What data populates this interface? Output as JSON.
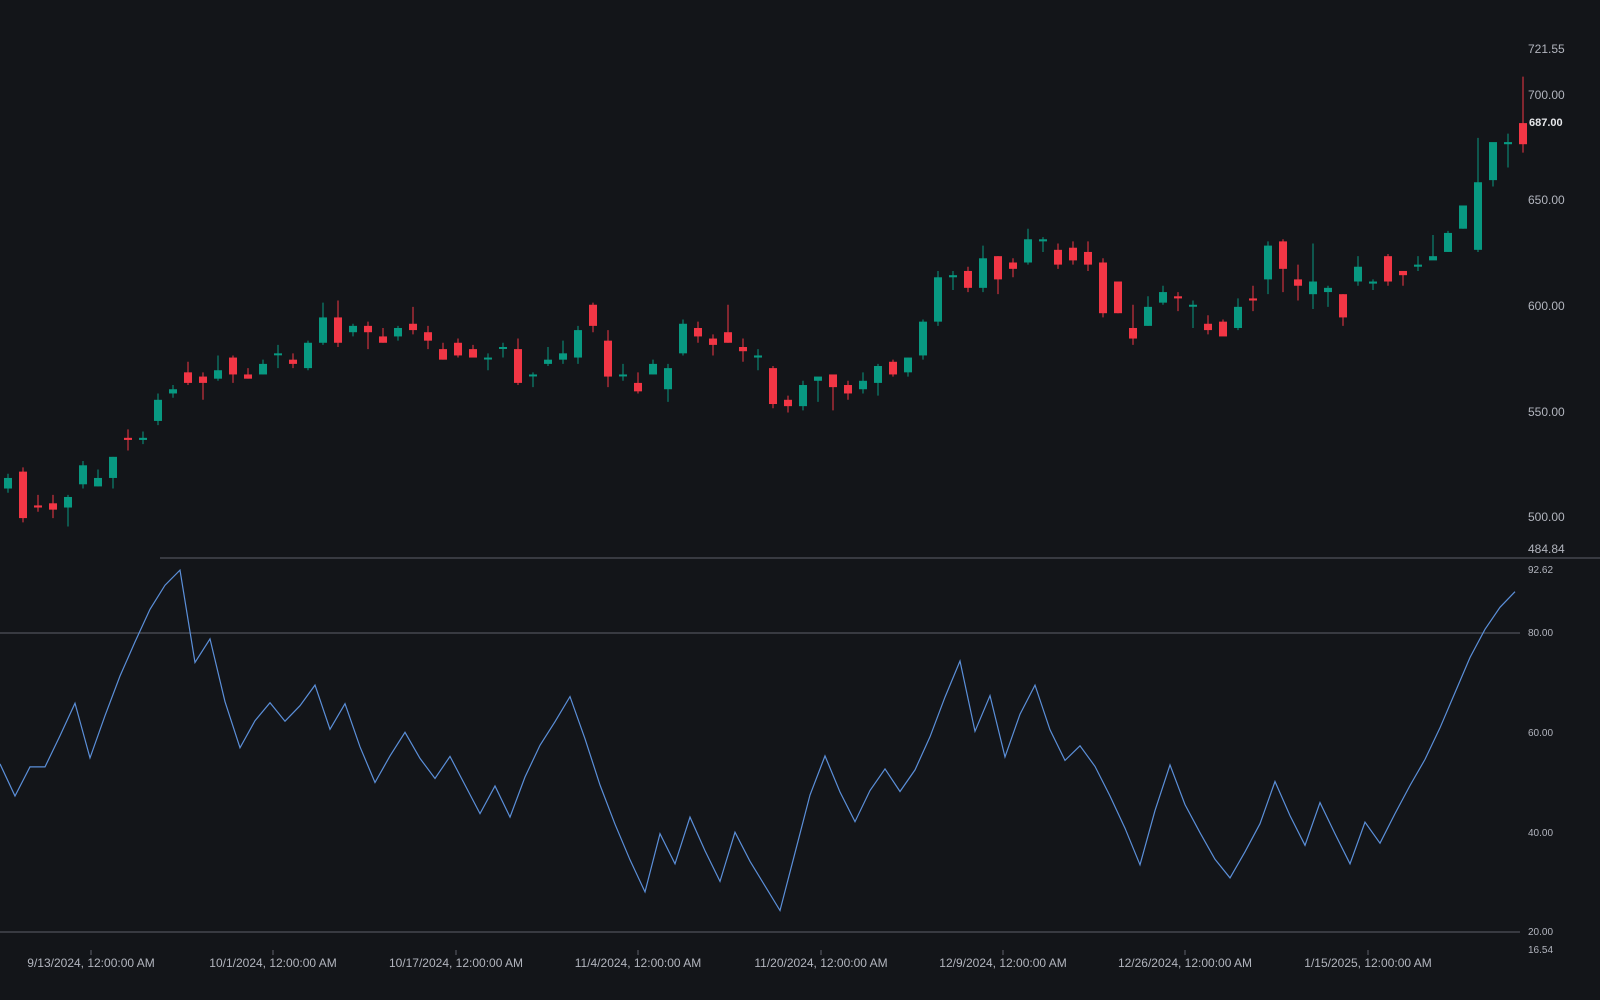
{
  "colors": {
    "background": "#131519",
    "up": "#089981",
    "down": "#f23645",
    "line": "#5b8fd9",
    "axis_text": "#b2b5be",
    "hline": "#5d6069"
  },
  "price_axis": {
    "labels": [
      "721.55",
      "700.00",
      "650.00",
      "600.00",
      "550.00",
      "500.00",
      "484.84"
    ],
    "last_price": "687.00"
  },
  "osc_axis": {
    "labels": [
      "92.62",
      "80.00",
      "60.00",
      "40.00",
      "20.00",
      "16.54"
    ]
  },
  "time_axis": {
    "labels": [
      "9/13/2024, 12:00:00 AM",
      "10/1/2024, 12:00:00 AM",
      "10/17/2024, 12:00:00 AM",
      "11/4/2024, 12:00:00 AM",
      "11/20/2024, 12:00:00 AM",
      "12/9/2024, 12:00:00 AM",
      "12/26/2024, 12:00:00 AM",
      "1/15/2025, 12:00:00 AM"
    ]
  },
  "chart_data": [
    {
      "type": "candlestick",
      "ylim": [
        484.84,
        721.55
      ],
      "x_ticks": [
        "9/13/2024, 12:00:00 AM",
        "10/1/2024, 12:00:00 AM",
        "10/17/2024, 12:00:00 AM",
        "11/4/2024, 12:00:00 AM",
        "11/20/2024, 12:00:00 AM",
        "12/9/2024, 12:00:00 AM",
        "12/26/2024, 12:00:00 AM",
        "1/15/2025, 12:00:00 AM"
      ],
      "ohlc": [
        [
          513,
          520,
          511,
          518
        ],
        [
          521,
          523,
          497,
          499
        ],
        [
          505,
          510,
          502,
          504
        ],
        [
          506,
          510,
          499,
          503
        ],
        [
          504,
          510,
          495,
          509
        ],
        [
          515,
          526,
          513,
          524
        ],
        [
          514,
          522,
          514,
          518
        ],
        [
          518,
          528,
          513,
          528
        ],
        [
          537,
          541,
          531,
          536
        ],
        [
          536,
          540,
          534,
          537
        ],
        [
          545,
          558,
          543,
          555
        ],
        [
          558,
          562,
          556,
          560
        ],
        [
          568,
          573,
          562,
          563
        ],
        [
          566,
          568,
          555,
          563
        ],
        [
          565,
          576,
          564,
          569
        ],
        [
          575,
          576,
          563,
          567
        ],
        [
          567,
          570,
          565,
          565
        ],
        [
          567,
          574,
          567,
          572
        ],
        [
          577,
          581,
          570,
          577
        ],
        [
          574,
          577,
          570,
          572
        ],
        [
          570,
          583,
          569,
          582
        ],
        [
          582,
          601,
          581,
          594
        ],
        [
          594,
          602,
          580,
          582
        ],
        [
          587,
          591,
          585,
          590
        ],
        [
          590,
          592,
          579,
          587
        ],
        [
          585,
          589,
          582,
          582
        ],
        [
          585,
          590,
          583,
          589
        ],
        [
          591,
          599,
          586,
          588
        ],
        [
          587,
          590,
          579,
          583
        ],
        [
          579,
          582,
          574,
          574
        ],
        [
          582,
          584,
          575,
          576
        ],
        [
          579,
          581,
          575,
          575
        ],
        [
          575,
          577,
          569,
          575
        ],
        [
          580,
          582,
          575,
          580
        ],
        [
          579,
          584,
          562,
          563
        ],
        [
          567,
          568,
          561,
          567
        ],
        [
          572,
          580,
          571,
          574
        ],
        [
          574,
          583,
          572,
          577
        ],
        [
          575,
          590,
          572,
          588
        ],
        [
          600,
          601,
          587,
          590
        ],
        [
          583,
          588,
          561,
          566
        ],
        [
          567,
          572,
          564,
          567
        ],
        [
          563,
          568,
          558,
          559
        ],
        [
          567,
          574,
          567,
          572
        ],
        [
          560,
          572,
          554,
          570
        ],
        [
          577,
          593,
          576,
          591
        ],
        [
          589,
          592,
          582,
          585
        ],
        [
          584,
          586,
          576,
          581
        ],
        [
          587,
          600,
          582,
          582
        ],
        [
          580,
          584,
          573,
          578
        ],
        [
          575,
          579,
          569,
          576
        ],
        [
          570,
          571,
          551,
          553
        ],
        [
          555,
          557,
          549,
          552
        ],
        [
          552,
          564,
          550,
          562
        ],
        [
          564,
          565,
          554,
          566
        ],
        [
          567,
          567,
          550,
          561
        ],
        [
          562,
          564,
          555,
          558
        ],
        [
          560,
          568,
          558,
          564
        ],
        [
          563,
          572,
          557,
          571
        ],
        [
          573,
          574,
          566,
          567
        ],
        [
          568,
          575,
          566,
          575
        ],
        [
          576,
          593,
          574,
          592
        ],
        [
          592,
          616,
          590,
          613
        ],
        [
          613,
          616,
          607,
          614
        ],
        [
          616,
          618,
          606,
          608
        ],
        [
          608,
          628,
          606,
          622
        ],
        [
          623,
          623,
          605,
          612
        ],
        [
          620,
          622,
          613,
          617
        ],
        [
          620,
          636,
          619,
          631
        ],
        [
          630,
          632,
          625,
          631
        ],
        [
          626,
          629,
          617,
          619
        ],
        [
          627,
          630,
          619,
          621
        ],
        [
          625,
          630,
          616,
          619
        ],
        [
          620,
          622,
          594,
          596
        ],
        [
          611,
          611,
          596,
          596
        ],
        [
          589,
          600,
          581,
          584
        ],
        [
          590,
          604,
          590,
          599
        ],
        [
          601,
          609,
          600,
          606
        ],
        [
          604,
          606,
          597,
          603
        ],
        [
          600,
          602,
          589,
          600
        ],
        [
          591,
          595,
          586,
          588
        ],
        [
          592,
          593,
          586,
          585
        ],
        [
          589,
          603,
          588,
          599
        ],
        [
          603,
          609,
          597,
          602
        ],
        [
          612,
          630,
          605,
          628
        ],
        [
          630,
          631,
          606,
          617
        ],
        [
          612,
          619,
          602,
          609
        ],
        [
          605,
          629,
          598,
          611
        ],
        [
          606,
          609,
          599,
          608
        ],
        [
          605,
          605,
          590,
          594
        ],
        [
          611,
          623,
          609,
          618
        ],
        [
          610,
          612,
          607,
          611
        ],
        [
          623,
          624,
          609,
          611
        ],
        [
          616,
          616,
          609,
          614
        ],
        [
          618,
          623,
          616,
          619
        ],
        [
          621,
          633,
          622,
          623
        ],
        [
          625,
          635,
          625,
          634
        ],
        [
          636,
          646,
          636,
          647
        ],
        [
          626,
          679,
          625,
          658
        ],
        [
          659,
          668,
          656,
          677
        ],
        [
          676,
          681,
          665,
          677
        ],
        [
          686,
          708,
          672,
          676
        ]
      ]
    },
    {
      "type": "line",
      "ylim": [
        16.54,
        92.62
      ],
      "reference_lines": [
        80,
        20
      ],
      "values": [
        54,
        47.6,
        53.4,
        53.4,
        59.6,
        66.1,
        55.2,
        63.6,
        71.5,
        78.3,
        84.8,
        89.6,
        92.6,
        74.2,
        78.9,
        66.4,
        57.2,
        62.6,
        66.2,
        62.5,
        65.6,
        69.7,
        60.9,
        66,
        57.4,
        50.3,
        55.6,
        60.3,
        55.1,
        51.1,
        55.5,
        49.8,
        44.1,
        49.6,
        43.4,
        51.4,
        57.7,
        62.4,
        67.4,
        59,
        49.8,
        42,
        34.9,
        28.5,
        40.1,
        34.1,
        43.4,
        36.7,
        30.6,
        40.4,
        34.6,
        29.7,
        24.8,
        36.3,
        47.8,
        55.6,
        48.4,
        42.5,
        48.7,
        53,
        48.5,
        52.8,
        59.4,
        67.3,
        74.5,
        60.5,
        67.6,
        55.4,
        63.9,
        69.7,
        60.8,
        54.7,
        57.6,
        53.5,
        47.6,
        41.2,
        33.9,
        44.7,
        53.8,
        45.9,
        40.3,
        35,
        31.3,
        36.5,
        42.1,
        50.5,
        43.7,
        37.8,
        46.3,
        40.1,
        34.1,
        42.4,
        38.2,
        44.1,
        49.7,
        54.9,
        61.2,
        68.2,
        75.2,
        80.8,
        85.2,
        88.3
      ]
    }
  ]
}
